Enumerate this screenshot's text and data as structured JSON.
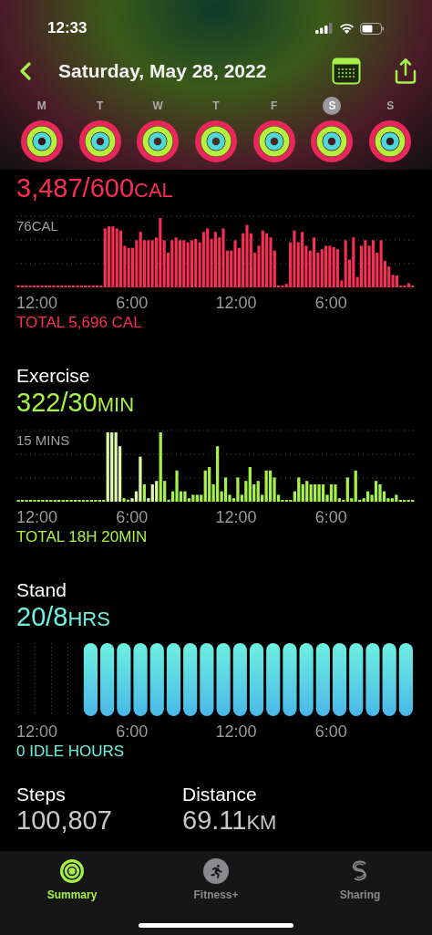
{
  "status_bar": {
    "time": "12:33"
  },
  "nav": {
    "title": "Saturday, May 28, 2022"
  },
  "week": [
    {
      "day": "M",
      "selected": false
    },
    {
      "day": "T",
      "selected": false
    },
    {
      "day": "W",
      "selected": false
    },
    {
      "day": "T",
      "selected": false
    },
    {
      "day": "F",
      "selected": false
    },
    {
      "day": "S",
      "selected": true
    },
    {
      "day": "S",
      "selected": false
    }
  ],
  "sections": [
    {
      "kind": "move",
      "value": "3,487/600",
      "unit": "CAL",
      "scale_label": "76CAL",
      "x_labels": [
        "12:00",
        "6:00",
        "12:00",
        "6:00"
      ],
      "total": "TOTAL 5,696 CAL",
      "color": "#fa2d55"
    },
    {
      "kind": "exercise",
      "title": "Exercise",
      "value": "322/30",
      "unit": "MIN",
      "scale_label": "15 MINS",
      "x_labels": [
        "12:00",
        "6:00",
        "12:00",
        "6:00"
      ],
      "total": "TOTAL 18H 20MIN",
      "color": "#a6f04a"
    },
    {
      "kind": "stand",
      "title": "Stand",
      "value": "20/8",
      "unit": "HRS",
      "x_labels": [
        "12:00",
        "6:00",
        "12:00",
        "6:00"
      ],
      "total": "0 IDLE HOURS",
      "color": "#6ef0e0"
    }
  ],
  "stats": [
    {
      "label": "Steps",
      "value": "100,807"
    },
    {
      "label": "Distance",
      "value": "69.11",
      "unit": "KM"
    }
  ],
  "tabs": [
    {
      "label": "Summary",
      "selected": true
    },
    {
      "label": "Fitness+",
      "selected": false
    },
    {
      "label": "Sharing",
      "selected": false
    }
  ]
}
